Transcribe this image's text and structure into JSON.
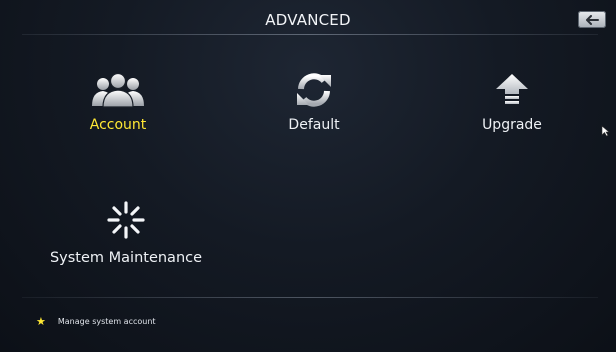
{
  "header": {
    "title": "ADVANCED"
  },
  "menu": {
    "items": [
      {
        "label": "Account",
        "icon": "users-icon",
        "selected": true
      },
      {
        "label": "Default",
        "icon": "refresh-icon",
        "selected": false
      },
      {
        "label": "Upgrade",
        "icon": "upload-arrow-icon",
        "selected": false
      },
      {
        "label": "System Maintenance",
        "icon": "spinner-icon",
        "selected": false
      }
    ]
  },
  "footer": {
    "hint": "Manage system account",
    "hint_icon": "star-icon"
  },
  "colors": {
    "highlight": "#ffe834",
    "text": "#eef1f5",
    "background": "#141a24"
  }
}
